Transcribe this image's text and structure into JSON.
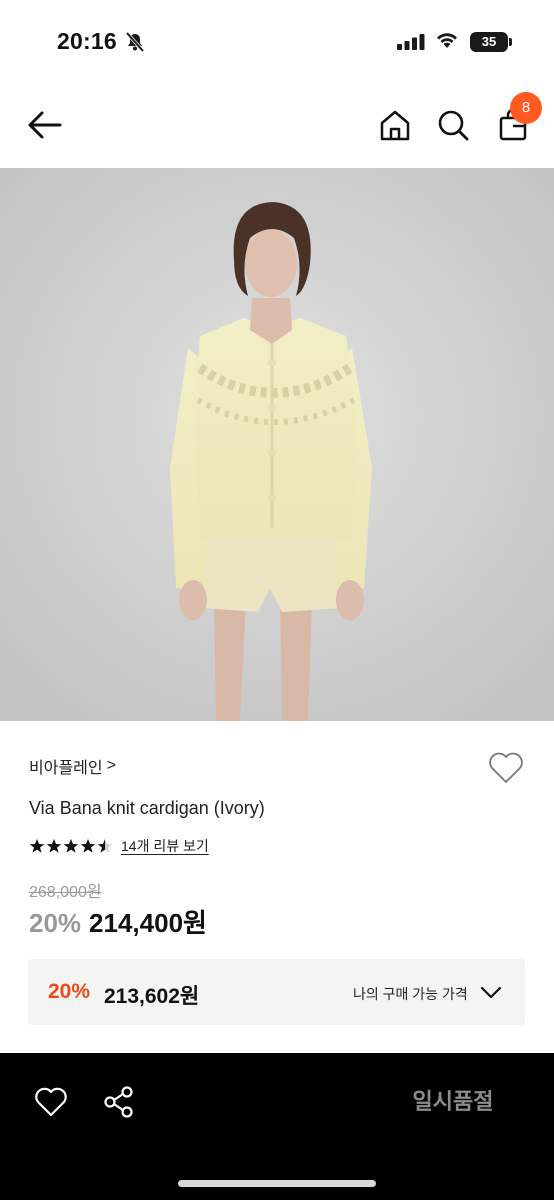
{
  "status_bar": {
    "time": "20:16",
    "battery": "35",
    "icons": [
      "bell-off-icon",
      "signal-icon",
      "wifi-icon",
      "battery-icon"
    ]
  },
  "header": {
    "icons": [
      "back-arrow-icon",
      "home-icon",
      "search-icon",
      "cart-icon"
    ],
    "cart_count": "8",
    "badge_color": "#ff5a1f"
  },
  "product": {
    "brand": "비아플레인",
    "brand_chevron": ">",
    "name": "Via Bana knit cardigan (Ivory)",
    "rating": 4.5,
    "review_link": "14개 리뷰 보기",
    "original_price": "268,000원",
    "discount_rate": "20%",
    "sale_price": "214,400원"
  },
  "my_price": {
    "discount_rate": "20%",
    "price": "213,602원",
    "label": "나의 구매 가능 가격",
    "accent_color": "#f04a14"
  },
  "bottom_bar": {
    "icons": [
      "heart-icon",
      "share-icon"
    ],
    "soldout_label": "일시품절"
  }
}
